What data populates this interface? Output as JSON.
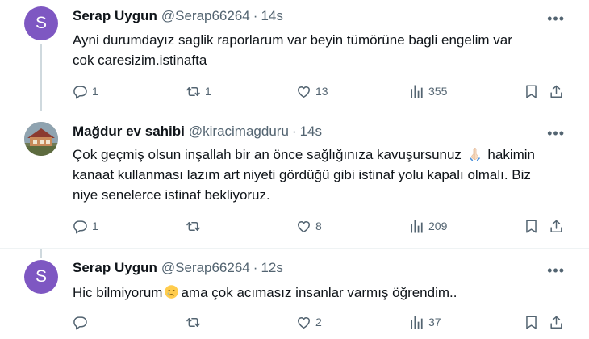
{
  "tweets": [
    {
      "author": "Serap Uygun",
      "handle": "@Serap66264",
      "separator": "·",
      "time": "14s",
      "avatar_letter": "S",
      "avatar_color": "#7e57c2",
      "text_line1": "Ayni durumdayız saglik raporlarum var beyin tümörüne bagli engelim var",
      "text_line2": "cok caresizim.istinafta",
      "replies": "1",
      "retweets": "1",
      "likes": "13",
      "views": "355"
    },
    {
      "author": "Mağdur ev sahibi",
      "handle": "@kiracimagduru",
      "separator": "·",
      "time": "14s",
      "text_line1a": "Çok geçmiş olsun inşallah bir an önce sağlığınıza kavuşursunuz",
      "emoji1": "folded-hands-emoji",
      "text_line1b": "hakimin",
      "text_line2": "kanaat kullanması lazım art niyeti gördüğü gibi istinaf yolu kapalı olmalı. Biz",
      "text_line3": "niye senelerce istinaf bekliyoruz.",
      "replies": "1",
      "retweets": "",
      "likes": "8",
      "views": "209"
    },
    {
      "author": "Serap Uygun",
      "handle": "@Serap66264",
      "separator": "·",
      "time": "12s",
      "avatar_letter": "S",
      "avatar_color": "#7e57c2",
      "text_a": "Hic bilmiyorum",
      "emoji1": "crying-face-emoji",
      "text_b": "ama çok acımasız insanlar varmış öğrendim..",
      "replies": "",
      "retweets": "",
      "likes": "2",
      "views": "37"
    }
  ],
  "more_glyph": "•••",
  "colors": {
    "text": "#0f1419",
    "secondary": "#536471",
    "divider": "#eff3f4"
  }
}
